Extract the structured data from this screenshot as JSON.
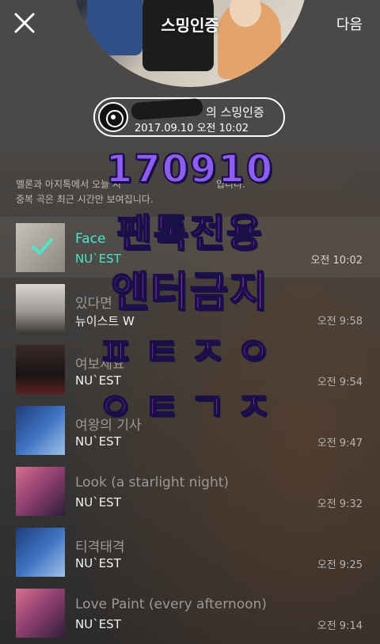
{
  "header": {
    "next_label": "다음",
    "cover_title": "스밍인증"
  },
  "streaming_badge": {
    "title": "의 스밍인증",
    "date": "2017.09.10 오전 10:02"
  },
  "notice": {
    "line1": "멜론과 아지톡에서 오늘 시",
    "line1_end": "입니다.",
    "line2": "중복 곡은 최근 시간만 보여집니다."
  },
  "songs": [
    {
      "title": "Face",
      "artist": "NU`EST",
      "time": "오전 10:02",
      "selected": true
    },
    {
      "title": "있다면",
      "artist": "뉴이스트 W",
      "time": "오전 9:58",
      "selected": false
    },
    {
      "title": "여보세요",
      "artist": "NU`EST",
      "time": "오전 9:54",
      "selected": false
    },
    {
      "title": "여왕의 기사",
      "artist": "NU`EST",
      "time": "오전 9:47",
      "selected": false
    },
    {
      "title": "Look (a starlight night)",
      "artist": "NU`EST",
      "time": "오전 9:32",
      "selected": false
    },
    {
      "title": "티격태격",
      "artist": "NU`EST",
      "time": "오전 9:25",
      "selected": false
    },
    {
      "title": "Love Paint (every afternoon)",
      "artist": "NU`EST",
      "time": "오전 9:14",
      "selected": false
    }
  ],
  "overlay": {
    "line1": "170910",
    "line2": "팬톡전용",
    "line3": "엔터금지",
    "line4": "ㅍㅌㅈㅇ",
    "line5": "ㅇㅌㄱㅈ"
  },
  "colors": {
    "accent": "#4de6c6",
    "overlay_pink": "#d23cf2",
    "overlay_purple": "#8d5cf0"
  },
  "album_covers": [
    "white-album-with-checkmark",
    "group-photo-light",
    "group-photo-dark",
    "blue-illustrated-cover",
    "nuest-pink-cover",
    "blue-illustrated-cover",
    "nuest-pink-cover"
  ]
}
